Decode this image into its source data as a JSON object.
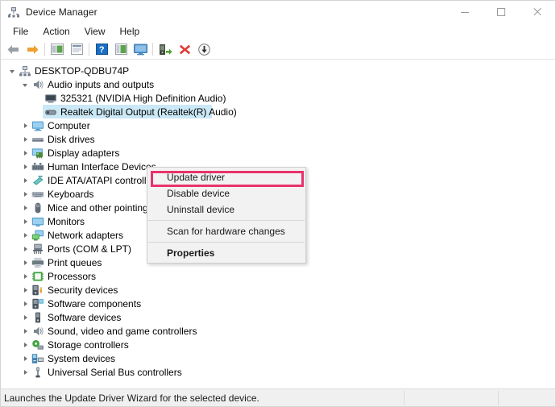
{
  "window": {
    "title": "Device Manager",
    "icon": "device-manager-icon",
    "controls": {
      "minimize": "minimize-button",
      "maximize": "maximize-button",
      "close": "close-button"
    }
  },
  "menubar": {
    "items": [
      {
        "label": "File",
        "name": "menu-file"
      },
      {
        "label": "Action",
        "name": "menu-action"
      },
      {
        "label": "View",
        "name": "menu-view"
      },
      {
        "label": "Help",
        "name": "menu-help"
      }
    ]
  },
  "toolbar": {
    "buttons": [
      {
        "name": "back-icon",
        "kind": "arrow-left"
      },
      {
        "name": "forward-icon",
        "kind": "arrow-right"
      },
      {
        "name": "separator-1",
        "kind": "separator"
      },
      {
        "name": "show-hide-console-tree-icon",
        "kind": "tree-panel"
      },
      {
        "name": "properties-icon",
        "kind": "properties-page"
      },
      {
        "name": "separator-2",
        "kind": "separator"
      },
      {
        "name": "help-icon",
        "kind": "help"
      },
      {
        "name": "scan-panel-icon",
        "kind": "green-panel"
      },
      {
        "name": "display-icon",
        "kind": "monitor"
      },
      {
        "name": "separator-3",
        "kind": "separator"
      },
      {
        "name": "update-driver-software-icon",
        "kind": "update-driver"
      },
      {
        "name": "uninstall-device-icon",
        "kind": "red-x"
      },
      {
        "name": "scan-for-hardware-changes-icon",
        "kind": "download-circle"
      }
    ]
  },
  "tree": {
    "nodes": [
      {
        "label": "DESKTOP-QDBU74P",
        "depth": 0,
        "twisty": "open",
        "icon": "computer-network-icon",
        "selected": false
      },
      {
        "label": "Audio inputs and outputs",
        "depth": 1,
        "twisty": "open",
        "icon": "speaker-icon",
        "selected": false
      },
      {
        "label": "325321 (NVIDIA High Definition Audio)",
        "depth": 2,
        "twisty": "none",
        "icon": "audio-device-icon",
        "selected": false
      },
      {
        "label": "Realtek Digital Output (Realtek(R) Audio)",
        "depth": 2,
        "twisty": "none",
        "icon": "speaker-device-icon",
        "selected": true
      },
      {
        "label": "Computer",
        "depth": 1,
        "twisty": "closed",
        "icon": "monitor-icon",
        "selected": false
      },
      {
        "label": "Disk drives",
        "depth": 1,
        "twisty": "closed",
        "icon": "disk-drive-icon",
        "selected": false
      },
      {
        "label": "Display adapters",
        "depth": 1,
        "twisty": "closed",
        "icon": "display-adapter-icon",
        "selected": false
      },
      {
        "label": "Human Interface Devices",
        "depth": 1,
        "twisty": "closed",
        "icon": "hid-icon",
        "selected": false
      },
      {
        "label": "IDE ATA/ATAPI controllers",
        "depth": 1,
        "twisty": "closed",
        "icon": "ide-controller-icon",
        "selected": false
      },
      {
        "label": "Keyboards",
        "depth": 1,
        "twisty": "closed",
        "icon": "keyboard-icon",
        "selected": false
      },
      {
        "label": "Mice and other pointing devices",
        "depth": 1,
        "twisty": "closed",
        "icon": "mouse-icon",
        "selected": false
      },
      {
        "label": "Monitors",
        "depth": 1,
        "twisty": "closed",
        "icon": "monitor-screen-icon",
        "selected": false
      },
      {
        "label": "Network adapters",
        "depth": 1,
        "twisty": "closed",
        "icon": "network-adapter-icon",
        "selected": false
      },
      {
        "label": "Ports (COM & LPT)",
        "depth": 1,
        "twisty": "closed",
        "icon": "port-icon",
        "selected": false
      },
      {
        "label": "Print queues",
        "depth": 1,
        "twisty": "closed",
        "icon": "printer-icon",
        "selected": false
      },
      {
        "label": "Processors",
        "depth": 1,
        "twisty": "closed",
        "icon": "processor-icon",
        "selected": false
      },
      {
        "label": "Security devices",
        "depth": 1,
        "twisty": "closed",
        "icon": "security-device-icon",
        "selected": false
      },
      {
        "label": "Software components",
        "depth": 1,
        "twisty": "closed",
        "icon": "software-component-icon",
        "selected": false
      },
      {
        "label": "Software devices",
        "depth": 1,
        "twisty": "closed",
        "icon": "software-device-icon",
        "selected": false
      },
      {
        "label": "Sound, video and game controllers",
        "depth": 1,
        "twisty": "closed",
        "icon": "sound-controller-icon",
        "selected": false
      },
      {
        "label": "Storage controllers",
        "depth": 1,
        "twisty": "closed",
        "icon": "storage-controller-icon",
        "selected": false
      },
      {
        "label": "System devices",
        "depth": 1,
        "twisty": "closed",
        "icon": "system-device-icon",
        "selected": false
      },
      {
        "label": "Universal Serial Bus controllers",
        "depth": 1,
        "twisty": "closed",
        "icon": "usb-icon",
        "selected": false
      }
    ]
  },
  "context_menu": {
    "items": [
      {
        "label": "Update driver",
        "name": "ctx-update-driver",
        "bold": false,
        "highlighted": true
      },
      {
        "label": "Disable device",
        "name": "ctx-disable-device",
        "bold": false,
        "highlighted": false
      },
      {
        "label": "Uninstall device",
        "name": "ctx-uninstall-device",
        "bold": false,
        "highlighted": false
      },
      {
        "label": "Scan for hardware changes",
        "name": "ctx-scan-hardware-changes",
        "bold": false,
        "highlighted": false
      },
      {
        "label": "Properties",
        "name": "ctx-properties",
        "bold": true,
        "highlighted": false
      }
    ],
    "highlight_color": "#e8336d"
  },
  "statusbar": {
    "message": "Launches the Update Driver Wizard for the selected device."
  },
  "colors": {
    "selection": "#cbe8f6",
    "highlight": "#e8336d",
    "status_bg": "#f0f0f0",
    "menu_bg": "#f2f2f2"
  }
}
